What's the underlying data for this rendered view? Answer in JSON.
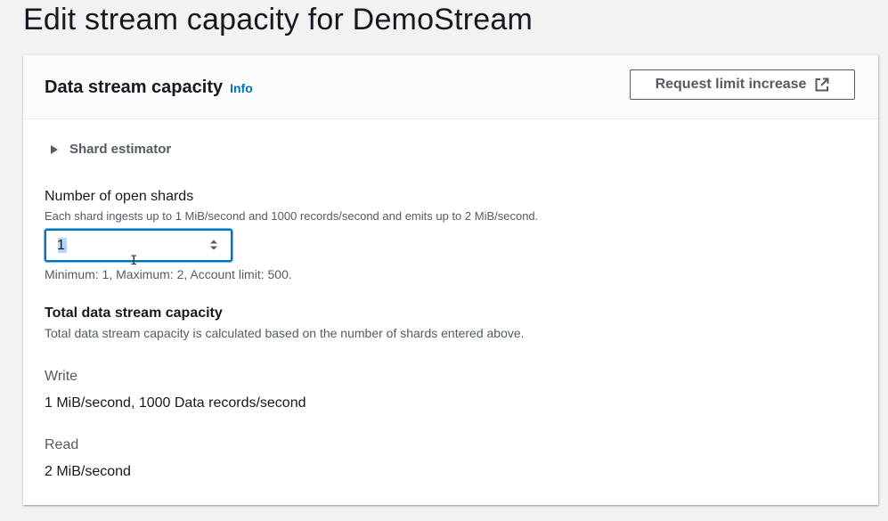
{
  "page": {
    "title": "Edit stream capacity for DemoStream"
  },
  "panel": {
    "title": "Data stream capacity",
    "info": "Info",
    "request_button": "Request limit increase"
  },
  "estimator": {
    "label": "Shard estimator"
  },
  "shards": {
    "label": "Number of open shards",
    "description": "Each shard ingests up to 1 MiB/second and 1000 records/second and emits up to 2 MiB/second.",
    "value": "1",
    "constraint": "Minimum: 1, Maximum: 2, Account limit: 500."
  },
  "capacity": {
    "title": "Total data stream capacity",
    "description": "Total data stream capacity is calculated based on the number of shards entered above.",
    "write_label": "Write",
    "write_value": "1 MiB/second, 1000 Data records/second",
    "read_label": "Read",
    "read_value": "2 MiB/second"
  },
  "icons": {
    "external": "external-link-icon",
    "caret": "caret-right-icon",
    "spinner": "number-spinner-icon"
  }
}
